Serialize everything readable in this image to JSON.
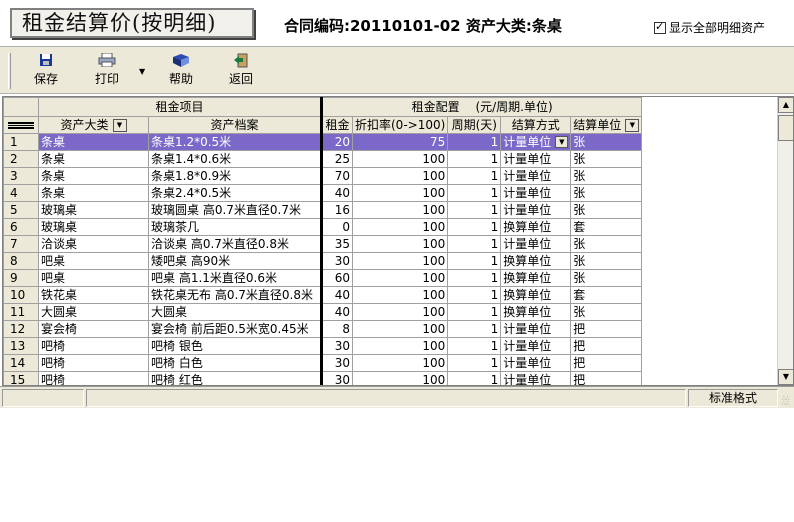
{
  "header": {
    "title": "租金结算价(按明细)",
    "contract_label": "合同编码:20110101-02  资产大类:条桌",
    "show_all_label": "显示全部明细资产",
    "show_all_checked": true
  },
  "toolbar": {
    "save_label": "保存",
    "print_label": "打印",
    "help_label": "帮助",
    "back_label": "返回"
  },
  "grid": {
    "group_left": "租金项目",
    "group_right": "租金配置　 (元/周期.单位)",
    "columns": {
      "category": "资产大类",
      "archive": "资产档案",
      "rent": "租金",
      "discount": "折扣率(0->100)",
      "period": "周期(天)",
      "settle_method": "结算方式",
      "settle_unit": "结算单位"
    },
    "rows": [
      {
        "n": "1",
        "category": "条桌",
        "archive": "条桌1.2*0.5米",
        "rent": "20",
        "discount": "75",
        "period": "1",
        "method": "计量单位",
        "unit": "张"
      },
      {
        "n": "2",
        "category": "条桌",
        "archive": "条桌1.4*0.6米",
        "rent": "25",
        "discount": "100",
        "period": "1",
        "method": "计量单位",
        "unit": "张"
      },
      {
        "n": "3",
        "category": "条桌",
        "archive": "条桌1.8*0.9米",
        "rent": "70",
        "discount": "100",
        "period": "1",
        "method": "计量单位",
        "unit": "张"
      },
      {
        "n": "4",
        "category": "条桌",
        "archive": "条桌2.4*0.5米",
        "rent": "40",
        "discount": "100",
        "period": "1",
        "method": "计量单位",
        "unit": "张"
      },
      {
        "n": "5",
        "category": "玻璃桌",
        "archive": "玻璃圆桌 高0.7米直径0.7米",
        "rent": "16",
        "discount": "100",
        "period": "1",
        "method": "计量单位",
        "unit": "张"
      },
      {
        "n": "6",
        "category": "玻璃桌",
        "archive": "玻璃茶几",
        "rent": "0",
        "discount": "100",
        "period": "1",
        "method": "换算单位",
        "unit": "套"
      },
      {
        "n": "7",
        "category": "洽谈桌",
        "archive": "洽谈桌 高0.7米直径0.8米",
        "rent": "35",
        "discount": "100",
        "period": "1",
        "method": "计量单位",
        "unit": "张"
      },
      {
        "n": "8",
        "category": "吧桌",
        "archive": "矮吧桌 高90米",
        "rent": "30",
        "discount": "100",
        "period": "1",
        "method": "换算单位",
        "unit": "张"
      },
      {
        "n": "9",
        "category": "吧桌",
        "archive": "吧桌 高1.1米直径0.6米",
        "rent": "60",
        "discount": "100",
        "period": "1",
        "method": "换算单位",
        "unit": "张"
      },
      {
        "n": "10",
        "category": "铁花桌",
        "archive": "铁花桌无布 高0.7米直径0.8米",
        "rent": "40",
        "discount": "100",
        "period": "1",
        "method": "换算单位",
        "unit": "套"
      },
      {
        "n": "11",
        "category": "大圆桌",
        "archive": "大圆桌",
        "rent": "40",
        "discount": "100",
        "period": "1",
        "method": "换算单位",
        "unit": "张"
      },
      {
        "n": "12",
        "category": "宴会椅",
        "archive": "宴会椅 前后距0.5米宽0.45米",
        "rent": "8",
        "discount": "100",
        "period": "1",
        "method": "计量单位",
        "unit": "把"
      },
      {
        "n": "13",
        "category": "吧椅",
        "archive": "吧椅 银色",
        "rent": "30",
        "discount": "100",
        "period": "1",
        "method": "计量单位",
        "unit": "把"
      },
      {
        "n": "14",
        "category": "吧椅",
        "archive": "吧椅 白色",
        "rent": "30",
        "discount": "100",
        "period": "1",
        "method": "计量单位",
        "unit": "把"
      },
      {
        "n": "15",
        "category": "吧椅",
        "archive": "吧椅 红色",
        "rent": "30",
        "discount": "100",
        "period": "1",
        "method": "计量单位",
        "unit": "把"
      }
    ]
  },
  "status": {
    "format_label": "标准格式"
  },
  "colors": {
    "selection": "#7b68c8",
    "chrome": "#ece9d8"
  }
}
